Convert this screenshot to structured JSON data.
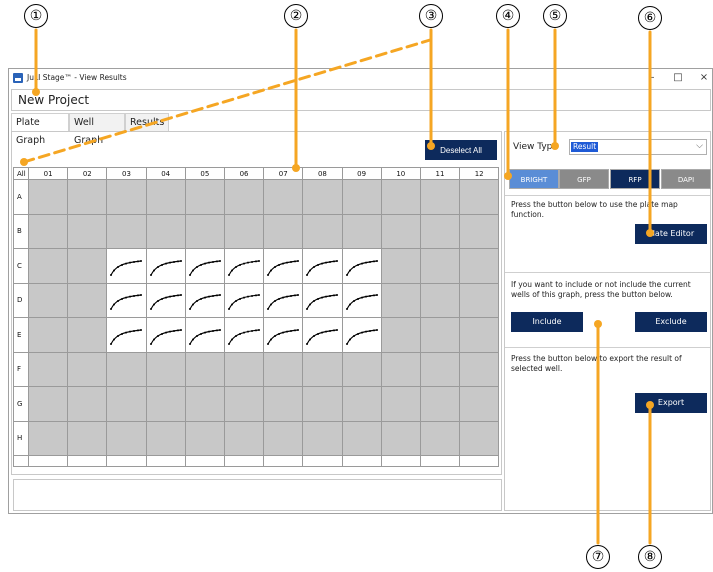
{
  "callouts": [
    "①",
    "②",
    "③",
    "④",
    "⑤",
    "⑥",
    "⑦",
    "⑧"
  ],
  "window": {
    "title": "JuLI Stage™ - View Results",
    "minimize": "–",
    "maximize": "□",
    "close": "×"
  },
  "project": {
    "name": "New Project"
  },
  "tabs": [
    {
      "label": "Plate Graph",
      "active": true
    },
    {
      "label": "Well Graph",
      "active": false
    },
    {
      "label": "Results",
      "active": false
    }
  ],
  "toolbar": {
    "deselect_label": "Deselect All"
  },
  "grid": {
    "corner_label": "All",
    "columns": [
      "01",
      "02",
      "03",
      "04",
      "05",
      "06",
      "07",
      "08",
      "09",
      "10",
      "11",
      "12"
    ],
    "rows": [
      "A",
      "B",
      "C",
      "D",
      "E",
      "F",
      "G",
      "H"
    ],
    "active_rows": [
      "C",
      "D",
      "E"
    ],
    "active_columns": [
      "03",
      "04",
      "05",
      "06",
      "07",
      "08",
      "09"
    ],
    "inactive_color": "#c8c8c8",
    "curve_color": "#000000"
  },
  "view_type": {
    "label": "View Type",
    "value": "Result"
  },
  "filters": [
    "BRIGHT",
    "GFP",
    "RFP",
    "DAPI"
  ],
  "plate_map": {
    "text": "Press the button below to use the plate map function.",
    "button": "Plate Editor"
  },
  "include_section": {
    "text": "If you want to include or not include the current wells of this graph, press the button below.",
    "include_button": "Include",
    "exclude_button": "Exclude"
  },
  "export_section": {
    "text": "Press the button below to export the result of selected well.",
    "button": "Export"
  },
  "colors": {
    "accent_navy": "#0d2a5c",
    "bright_button": "#5a8dd6",
    "inactive_button": "#8a8a8a",
    "callout_orange": "#f5a623"
  }
}
